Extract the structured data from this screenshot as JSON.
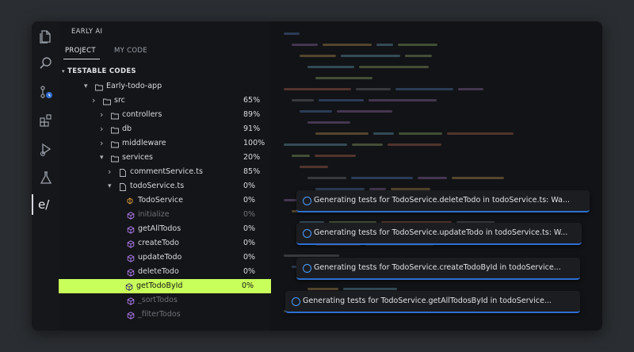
{
  "app": {
    "sidebar_title": "EARLY AI",
    "logo_text": "e/"
  },
  "tabs": [
    {
      "label": "PROJECT"
    },
    {
      "label": "MY CODE"
    }
  ],
  "section": {
    "title": "TESTABLE CODES"
  },
  "tree": [
    {
      "label": "Early-todo-app",
      "pct": "",
      "kind": "folder",
      "depth": 0,
      "chevron": "down"
    },
    {
      "label": "src",
      "pct": "65%",
      "kind": "folder",
      "depth": 1,
      "chevron": "right"
    },
    {
      "label": "controllers",
      "pct": "89%",
      "kind": "folder",
      "depth": 2,
      "chevron": "right"
    },
    {
      "label": "db",
      "pct": "91%",
      "kind": "folder",
      "depth": 2,
      "chevron": "right"
    },
    {
      "label": "middleware",
      "pct": "100%",
      "kind": "folder",
      "depth": 2,
      "chevron": "right"
    },
    {
      "label": "services",
      "pct": "20%",
      "kind": "folder",
      "depth": 2,
      "chevron": "down"
    },
    {
      "label": "commentService.ts",
      "pct": "85%",
      "kind": "file",
      "depth": 3,
      "chevron": "right"
    },
    {
      "label": "todoService.ts",
      "pct": "0%",
      "kind": "file",
      "depth": 3,
      "chevron": "down"
    },
    {
      "label": "TodoService",
      "pct": "0%",
      "kind": "class",
      "depth": 4
    },
    {
      "label": "initialize",
      "pct": "0%",
      "kind": "method",
      "depth": 4,
      "dim": true
    },
    {
      "label": "getAllTodos",
      "pct": "0%",
      "kind": "method",
      "depth": 4,
      "dot": true
    },
    {
      "label": "createTodo",
      "pct": "0%",
      "kind": "method",
      "depth": 4,
      "dot": true
    },
    {
      "label": "updateTodo",
      "pct": "0%",
      "kind": "method",
      "depth": 4,
      "dot": true
    },
    {
      "label": "deleteTodo",
      "pct": "0%",
      "kind": "method",
      "depth": 4,
      "dot": true
    },
    {
      "label": "getTodoById",
      "pct": "0%",
      "kind": "method",
      "depth": 4,
      "selected": true
    },
    {
      "label": "_sortTodos",
      "pct": "",
      "kind": "method",
      "depth": 4,
      "dim": true
    },
    {
      "label": "_filterTodos",
      "pct": "",
      "kind": "method",
      "depth": 4,
      "dim": true
    }
  ],
  "notifications": [
    {
      "text": "Generating tests for TodoService.deleteTodo in todoService.ts: Wa..."
    },
    {
      "text": "Generating tests for TodoService.updateTodo in todoService.ts: W..."
    },
    {
      "text": "Generating tests for TodoService.createTodoById in todoService..."
    },
    {
      "text": "Generating tests for TodoService.getAllTodosById in todoService..."
    }
  ],
  "colors": {
    "accent": "#c8ff5a",
    "info": "#4a9eff",
    "selection": "#c8ff5a"
  },
  "activity_icons": [
    "files-icon",
    "search-icon",
    "source-control-icon",
    "extensions-icon",
    "run-debug-icon",
    "testing-icon",
    "early-ai-icon"
  ]
}
